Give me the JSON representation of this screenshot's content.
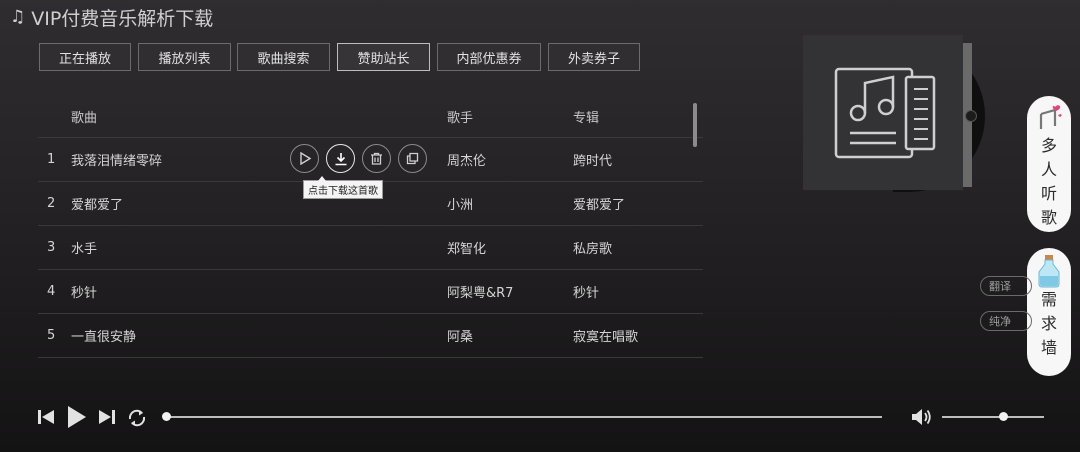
{
  "app": {
    "title": "VIP付费音乐解析下载"
  },
  "tabs": [
    {
      "label": "正在播放",
      "active": false
    },
    {
      "label": "播放列表",
      "active": false
    },
    {
      "label": "歌曲搜索",
      "active": false
    },
    {
      "label": "赞助站长",
      "active": true
    },
    {
      "label": "内部优惠券",
      "active": false
    },
    {
      "label": "外卖券子",
      "active": false
    }
  ],
  "list": {
    "headers": {
      "song": "歌曲",
      "singer": "歌手",
      "album": "专辑"
    },
    "rows": [
      {
        "num": "1",
        "song": "我落泪情绪零碎",
        "singer": "周杰伦",
        "album": "跨时代"
      },
      {
        "num": "2",
        "song": "爱都爱了",
        "singer": "小洲",
        "album": "爱都爱了"
      },
      {
        "num": "3",
        "song": "水手",
        "singer": "郑智化",
        "album": "私房歌"
      },
      {
        "num": "4",
        "song": "秒针",
        "singer": "阿梨粤&R7",
        "album": "秒针"
      },
      {
        "num": "5",
        "song": "一直很安静",
        "singer": "阿桑",
        "album": "寂寞在唱歌"
      }
    ],
    "row_actions": [
      "play-icon",
      "download-icon",
      "delete-icon",
      "share-icon"
    ],
    "tooltip": "点击下载这首歌"
  },
  "side": {
    "listen_together": "多\n人\n听\n歌",
    "wish_wall": "需\n求\n墙",
    "translate_toggle": "翻译",
    "pure_toggle": "纯净"
  },
  "player": {
    "progress": 0.0,
    "volume": 0.6,
    "icons": [
      "prev-icon",
      "play-icon",
      "next-icon",
      "loop-icon",
      "volume-icon"
    ]
  }
}
